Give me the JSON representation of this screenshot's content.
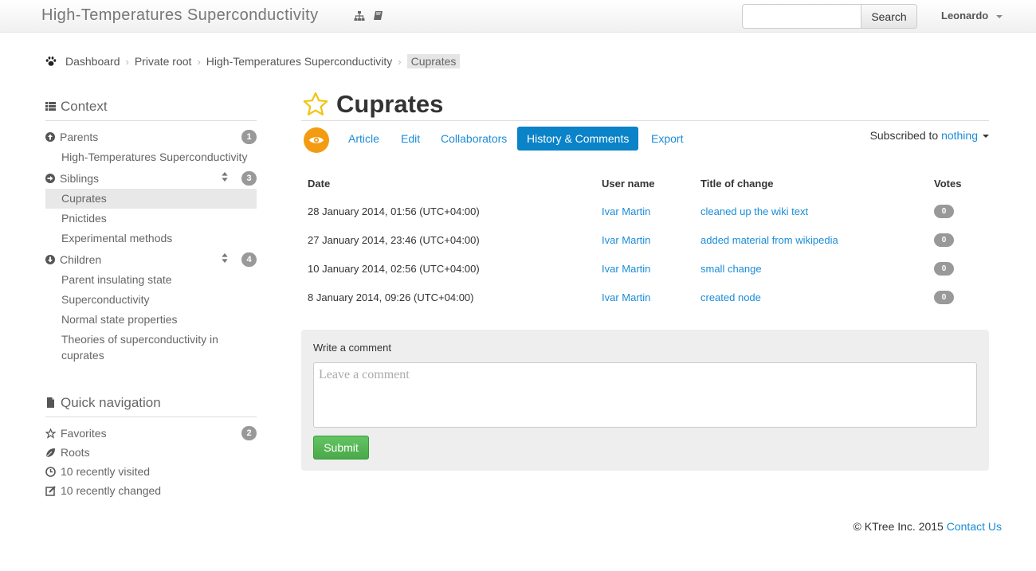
{
  "navbar": {
    "brand": "High-Temperatures Superconductivity",
    "search_placeholder": "",
    "search_button": "Search",
    "user": "Leonardo"
  },
  "breadcrumb": [
    "Dashboard",
    "Private root",
    "High-Temperatures Superconductivity",
    "Cuprates"
  ],
  "sidebar": {
    "context_heading": "Context",
    "parents": {
      "label": "Parents",
      "count": "1",
      "items": [
        "High-Temperatures Superconductivity"
      ]
    },
    "siblings": {
      "label": "Siblings",
      "count": "3",
      "items": [
        "Cuprates",
        "Pnictides",
        "Experimental methods"
      ],
      "active": "Cuprates"
    },
    "children": {
      "label": "Children",
      "count": "4",
      "items": [
        "Parent insulating state",
        "Superconductivity",
        "Normal state properties",
        "Theories of superconductivity in cuprates"
      ]
    },
    "quick_nav_heading": "Quick navigation",
    "quick_nav": [
      {
        "label": "Favorites",
        "icon": "star-icon",
        "count": "2"
      },
      {
        "label": "Roots",
        "icon": "leaf-icon"
      },
      {
        "label": "10 recently visited",
        "icon": "clock-icon"
      },
      {
        "label": "10 recently changed",
        "icon": "edit-icon"
      }
    ]
  },
  "main": {
    "title": "Cuprates",
    "tabs": [
      "Article",
      "Edit",
      "Collaborators",
      "History & Comments",
      "Export"
    ],
    "active_tab": "History & Comments",
    "subscribed_label": "Subscribed to",
    "subscribed_value": "nothing",
    "history": {
      "columns": [
        "Date",
        "User name",
        "Title of change",
        "Votes"
      ],
      "rows": [
        {
          "date": "28 January 2014, 01:56 (UTC+04:00)",
          "user": "Ivar Martin",
          "title": "cleaned up the wiki text",
          "votes": "0"
        },
        {
          "date": "27 January 2014, 23:46 (UTC+04:00)",
          "user": "Ivar Martin",
          "title": "added material from wikipedia",
          "votes": "0"
        },
        {
          "date": "10 January 2014, 02:56 (UTC+04:00)",
          "user": "Ivar Martin",
          "title": "small change",
          "votes": "0"
        },
        {
          "date": "8 January 2014, 09:26 (UTC+04:00)",
          "user": "Ivar Martin",
          "title": "created node",
          "votes": "0"
        }
      ]
    },
    "comment": {
      "label": "Write a comment",
      "placeholder": "Leave a comment",
      "submit": "Submit"
    }
  },
  "footer": {
    "copyright": "© KTree Inc. 2015",
    "contact": "Contact Us"
  },
  "colors": {
    "link": "#1a8cd8",
    "active_tab": "#0a83c8",
    "eye_button": "#f39c12",
    "submit": "#5cb85c",
    "star": "#f1c40f"
  }
}
